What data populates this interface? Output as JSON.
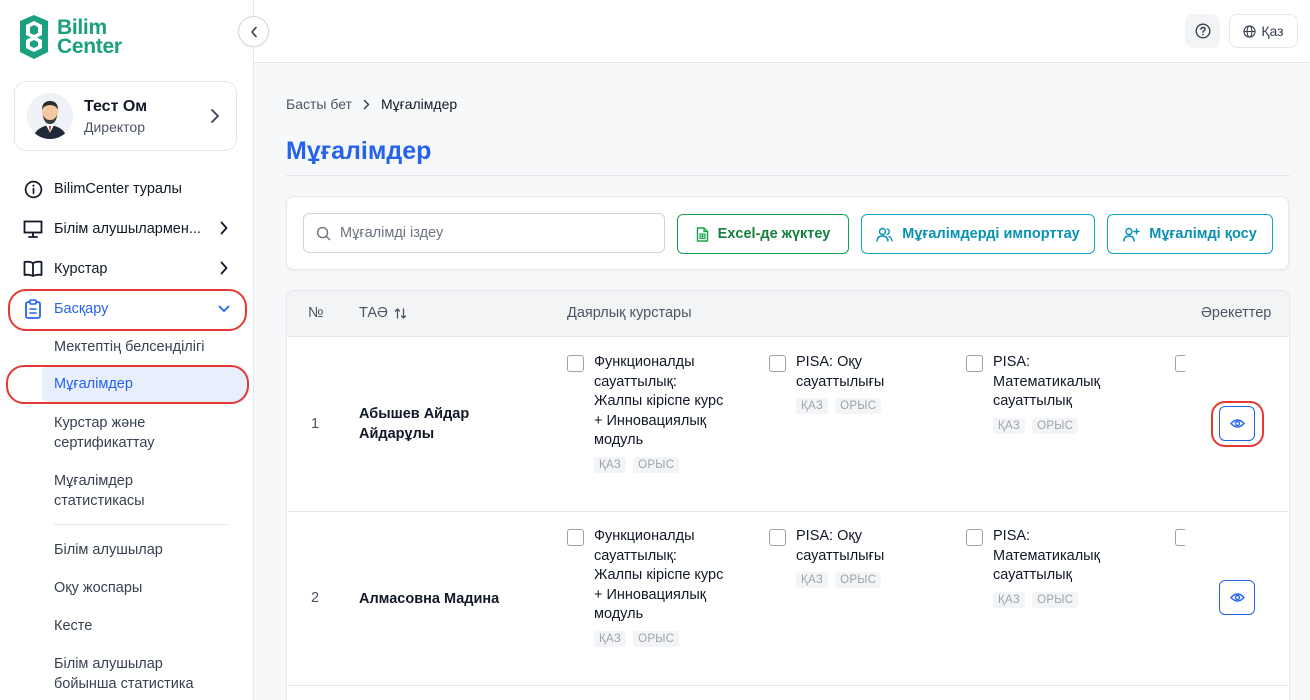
{
  "logo": {
    "line1": "Bilim",
    "line2": "Center"
  },
  "profile": {
    "name": "Тест Ом",
    "role": "Директор"
  },
  "nav": [
    {
      "label": "BilimCenter туралы",
      "icon": "info-icon"
    },
    {
      "label": "Білім алушылармен...",
      "icon": "monitor-icon"
    },
    {
      "label": "Курстар",
      "icon": "book-icon"
    },
    {
      "label": "Басқару",
      "icon": "clipboard-icon"
    }
  ],
  "subnav": [
    "Мектептің белсенділігі",
    "Мұғалімдер",
    "Курстар және сертификаттау",
    "Мұғалімдер статистикасы",
    "Білім алушылар",
    "Оқу жоспары",
    "Кесте",
    "Білім алушылар бойынша статистика"
  ],
  "topbar": {
    "language": "Қаз"
  },
  "breadcrumb": {
    "home": "Басты бет",
    "current": "Мұғалімдер"
  },
  "page_title": "Мұғалімдер",
  "toolbar": {
    "search_placeholder": "Мұғалімді іздеу",
    "excel_label": "Excel-де жүктеу",
    "import_label": "Мұғалімдерді импорттау",
    "add_label": "Мұғалімді қосу"
  },
  "table": {
    "headers": {
      "num": "№",
      "name": "ТАӘ",
      "courses": "Даярлық курстары",
      "actions": "Әрекеттер"
    },
    "course_titles": [
      "Функционалды сауаттылық: Жалпы кіріспе курс + Инновациялық модуль",
      "PISA: Оқу сауаттылығы",
      "PISA: Математикалық сауаттылық"
    ],
    "tags": [
      "ҚАЗ",
      "ОРЫС"
    ],
    "rows": [
      {
        "num": "1",
        "name": "Абышев Айдар Айдарұлы"
      },
      {
        "num": "2",
        "name": "Алмасовна Мадина"
      }
    ]
  },
  "colors": {
    "accent": "#2563eb",
    "brand": "#1aa07e",
    "highlight": "#e53935"
  }
}
